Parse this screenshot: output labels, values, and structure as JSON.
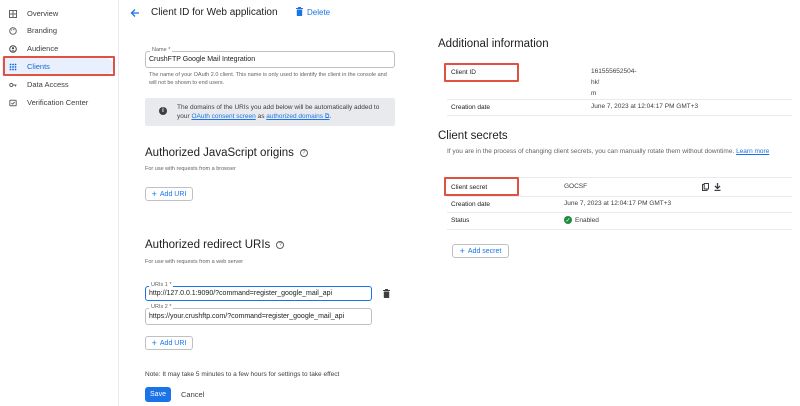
{
  "sidebar": {
    "items": [
      {
        "label": "Overview",
        "icon": "overview-grid-icon"
      },
      {
        "label": "Branding",
        "icon": "palette-icon"
      },
      {
        "label": "Audience",
        "icon": "person-icon"
      },
      {
        "label": "Clients",
        "icon": "clients-grid-icon",
        "active": true
      },
      {
        "label": "Data Access",
        "icon": "key-icon"
      },
      {
        "label": "Verification Center",
        "icon": "verified-icon"
      }
    ]
  },
  "header": {
    "title": "Client ID for Web application",
    "delete_label": "Delete"
  },
  "form": {
    "name": {
      "label": "Name *",
      "value": "CrushFTP Google Mail Integration",
      "help": "The name of your OAuth 2.0 client. This name is only used to identify the client in the console and will not be shown to end users."
    },
    "info": {
      "text_before": "The domains of the URIs you add below will be automatically added to your ",
      "link1": "OAuth consent screen",
      "text_mid": " as ",
      "link2": "authorized domains",
      "text_after": "."
    },
    "js_origins": {
      "title": "Authorized JavaScript origins",
      "subtitle": "For use with requests from a browser",
      "add_label": "Add URI"
    },
    "redirects": {
      "title": "Authorized redirect URIs",
      "subtitle": "For use with requests from a web server",
      "uris": [
        {
          "label": "URIs 1 *",
          "value": "http://127.0.0.1:9090/?command=register_google_mail_api"
        },
        {
          "label": "URIs 2 *",
          "value": "https://your.crushftp.com/?command=register_google_mail_api"
        }
      ],
      "add_label": "Add URI"
    },
    "note": "Note: It may take 5 minutes to a few hours for settings to take effect",
    "save_label": "Save",
    "cancel_label": "Cancel"
  },
  "additional": {
    "title": "Additional information",
    "client_id_label": "Client ID",
    "client_id_lines": [
      "161555652504-",
      "hk!",
      "m"
    ],
    "creation_label": "Creation date",
    "creation_value": "June 7, 2023 at 12:04:17 PM GMT+3"
  },
  "secrets": {
    "title": "Client secrets",
    "desc": "If you are in the process of changing client secrets, you can manually rotate them without downtime.",
    "learn_more": "Learn more",
    "secret_label": "Client secret",
    "secret_value": "GOCSF",
    "creation_label": "Creation date",
    "creation_value": "June 7, 2023 at 12:04:17 PM GMT+3",
    "status_label": "Status",
    "status_value": "Enabled",
    "add_label": "Add secret"
  },
  "colors": {
    "accent": "#1a73e8",
    "highlight": "#e0513f",
    "active_bg": "#e8f0fe"
  }
}
